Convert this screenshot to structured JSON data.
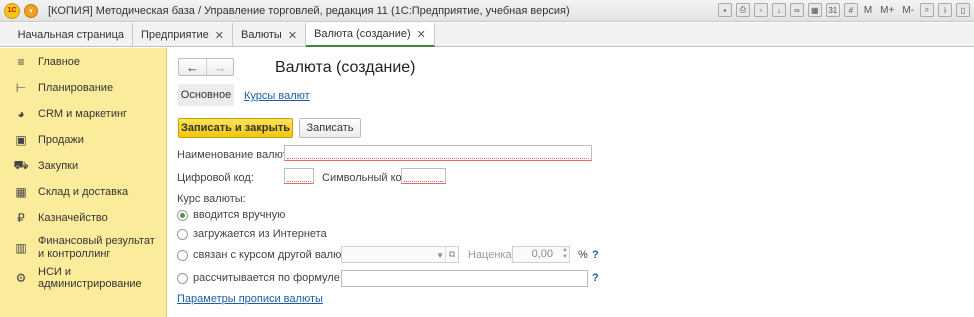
{
  "window": {
    "title": "[КОПИЯ] Методическая база / Управление торговлей, редакция 11  (1С:Предприятие, учебная версия)",
    "tools": [
      "M",
      "M+",
      "M-"
    ]
  },
  "tabs": [
    {
      "label": "Начальная страница",
      "closable": false
    },
    {
      "label": "Предприятие",
      "closable": true
    },
    {
      "label": "Валюты",
      "closable": true
    },
    {
      "label": "Валюта (создание)",
      "closable": true,
      "active": true
    }
  ],
  "sidebar": {
    "items": [
      {
        "label": "Главное",
        "icon": "menu-lines-icon"
      },
      {
        "label": "Планирование",
        "icon": "planning-icon"
      },
      {
        "label": "CRM и маркетинг",
        "icon": "pie-chart-icon"
      },
      {
        "label": "Продажи",
        "icon": "shopping-bag-icon"
      },
      {
        "label": "Закупки",
        "icon": "basket-icon"
      },
      {
        "label": "Склад и доставка",
        "icon": "warehouse-icon"
      },
      {
        "label": "Казначейство",
        "icon": "coin-icon"
      },
      {
        "label": "Финансовый результат и контроллинг",
        "icon": "bar-chart-icon"
      },
      {
        "label": "НСИ и администрирование",
        "icon": "gear-icon"
      }
    ]
  },
  "form": {
    "title": "Валюта (создание)",
    "subtabs": {
      "main": "Основное",
      "rates_link": "Курсы валют"
    },
    "buttons": {
      "save_close": "Записать и закрыть",
      "save": "Записать"
    },
    "fields": {
      "name_label": "Наименование валюты:",
      "name_value": "",
      "digital_code_label": "Цифровой код:",
      "digital_code_value": "",
      "symbol_code_label": "Символьный код:",
      "symbol_code_value": ""
    },
    "rate": {
      "label": "Курс валюты:",
      "options": [
        {
          "label": "вводится вручную",
          "selected": true
        },
        {
          "label": "загружается из Интернета",
          "selected": false
        },
        {
          "label": "связан с курсом другой валюты:",
          "selected": false
        },
        {
          "label": "рассчитывается по формуле:",
          "selected": false
        }
      ],
      "markup_label": "Наценка:",
      "markup_value": "0,00",
      "percent_sign": "%",
      "help": "?"
    },
    "footer_link": "Параметры прописи валюты"
  }
}
